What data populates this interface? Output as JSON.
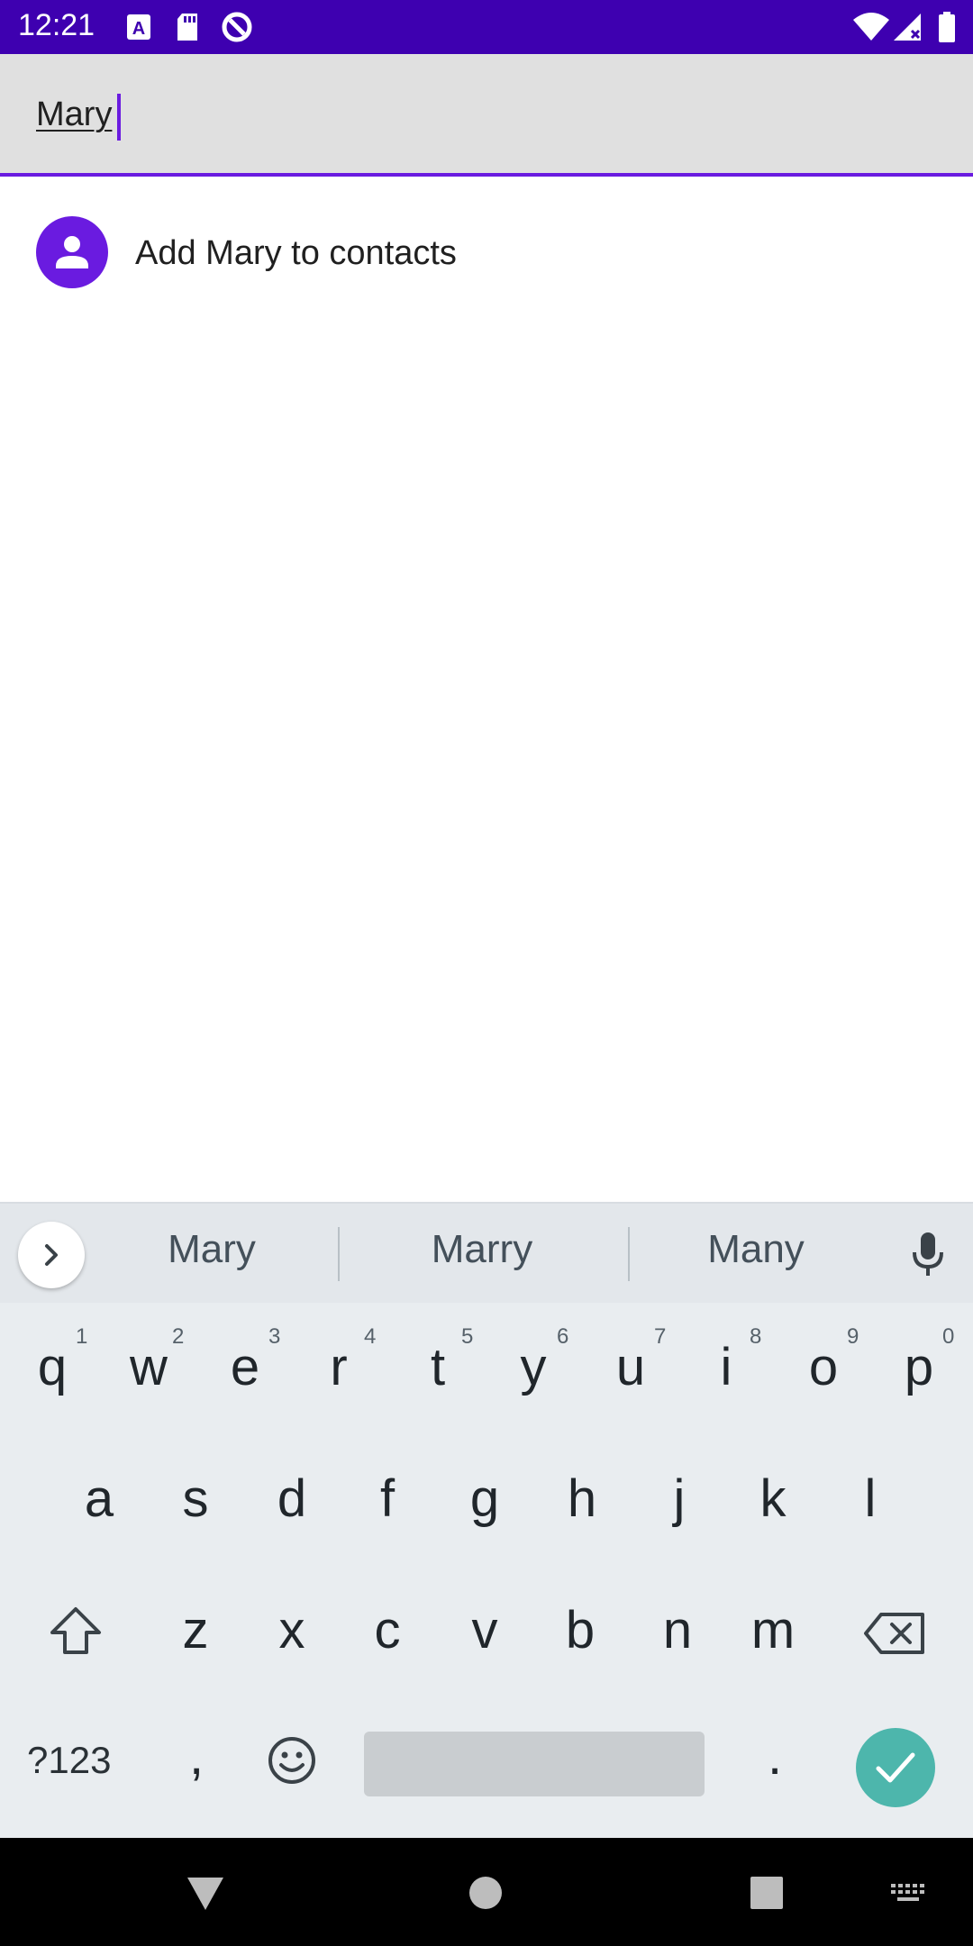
{
  "status_bar": {
    "time": "12:21",
    "notification_icons": [
      "font-a-icon",
      "sd-card-icon",
      "data-saver-icon"
    ],
    "system_icons": [
      "wifi-icon",
      "cell-signal-icon",
      "battery-icon"
    ],
    "background": "#3e00b0"
  },
  "search": {
    "value": "Mary",
    "accent": "#6a1be0"
  },
  "results": [
    {
      "label": "Add Mary to contacts",
      "icon": "person-icon"
    }
  ],
  "keyboard": {
    "suggestions": [
      "Mary",
      "Marry",
      "Many"
    ],
    "row1": [
      {
        "key": "q",
        "hint": "1"
      },
      {
        "key": "w",
        "hint": "2"
      },
      {
        "key": "e",
        "hint": "3"
      },
      {
        "key": "r",
        "hint": "4"
      },
      {
        "key": "t",
        "hint": "5"
      },
      {
        "key": "y",
        "hint": "6"
      },
      {
        "key": "u",
        "hint": "7"
      },
      {
        "key": "i",
        "hint": "8"
      },
      {
        "key": "o",
        "hint": "9"
      },
      {
        "key": "p",
        "hint": "0"
      }
    ],
    "row2": [
      "a",
      "s",
      "d",
      "f",
      "g",
      "h",
      "j",
      "k",
      "l"
    ],
    "row3": [
      "z",
      "x",
      "c",
      "v",
      "b",
      "n",
      "m"
    ],
    "symbols_label": "?123",
    "comma": ",",
    "period": ".",
    "enter_color": "#4db6ac"
  },
  "nav_bar": {
    "icons": [
      "back-icon",
      "home-icon",
      "recents-icon",
      "keyboard-switch-icon"
    ]
  }
}
